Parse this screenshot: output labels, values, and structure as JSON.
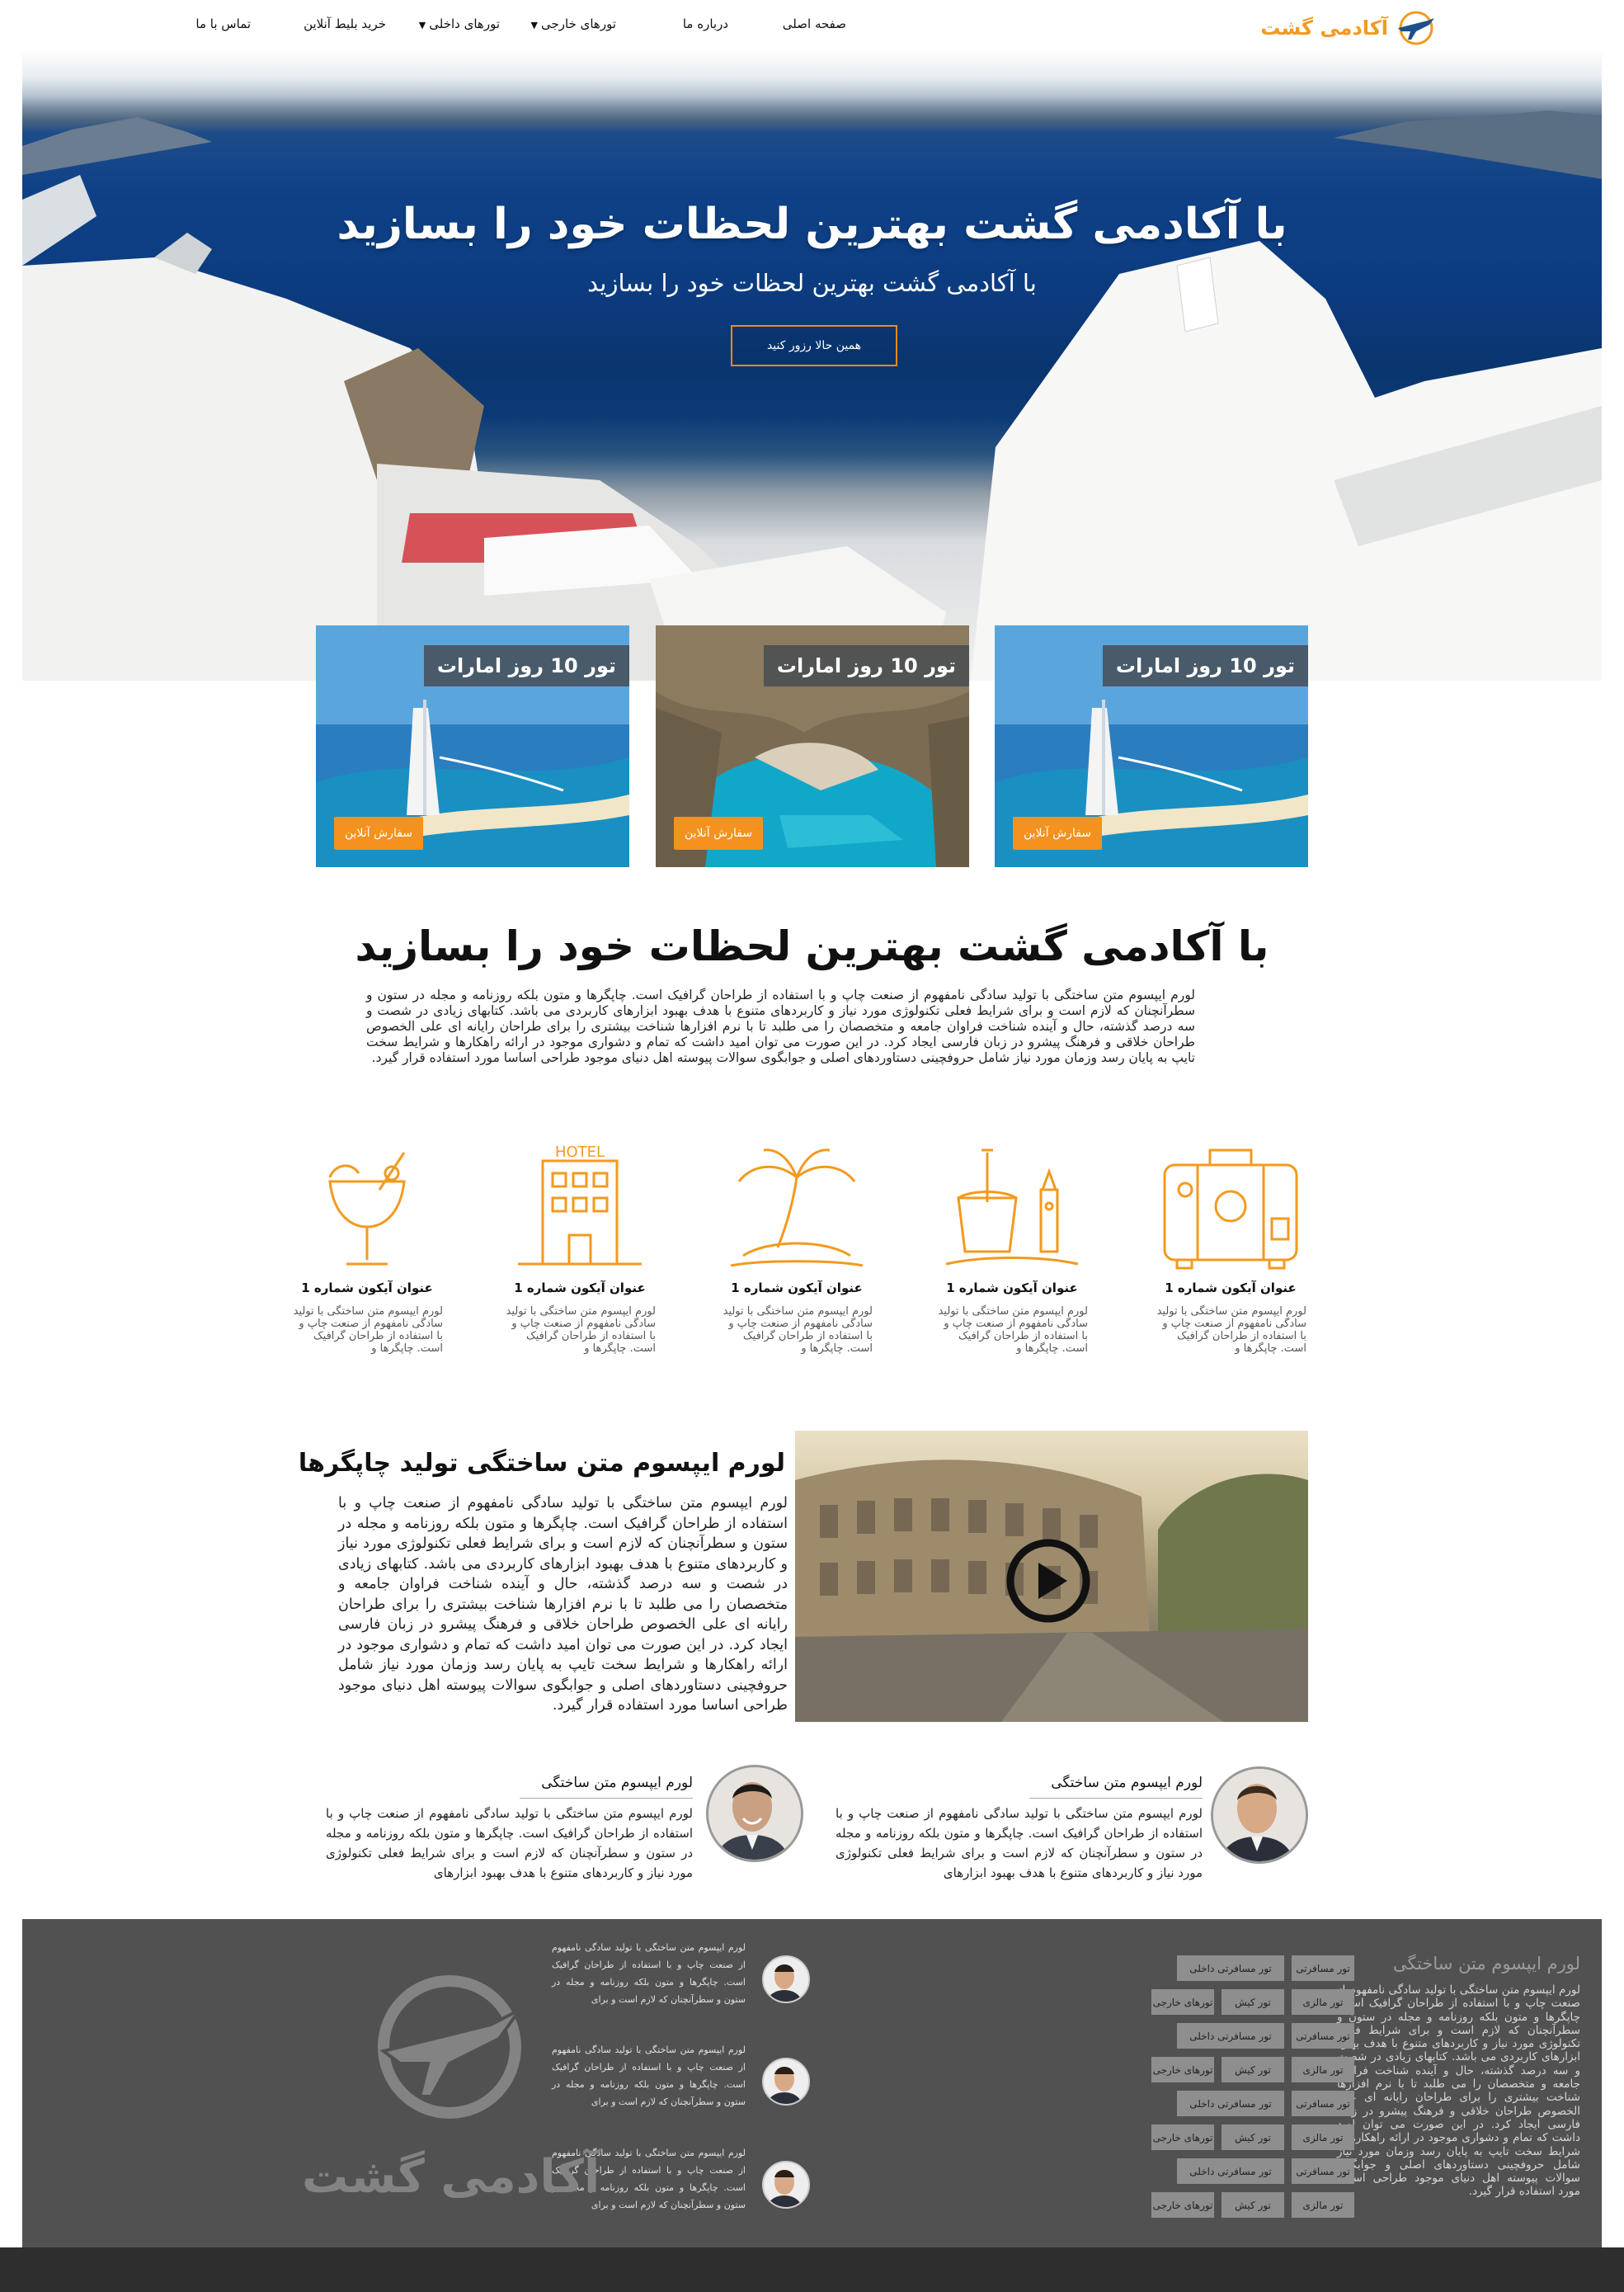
{
  "nav": {
    "brand": "آکادمی گشت",
    "items": [
      "صفحه اصلی",
      "درباره ما",
      "تورهای خارجی",
      "تورهای داخلی",
      "خرید بلیط آنلاین",
      "تماس با ما"
    ]
  },
  "hero": {
    "title": "با آکادمی گشت بهترین لحظات خود را بسازید",
    "subtitle": "با آکادمی گشت بهترین لحظات خود را بسازید",
    "button": "همین حالا رزور کنید"
  },
  "tours": [
    {
      "title": "تور 10 روز امارات",
      "button": "سفارش آنلاین",
      "image": "burj-al-arab"
    },
    {
      "title": "تور 10 روز امارات",
      "button": "سفارش آنلاین",
      "image": "navagio-beach"
    },
    {
      "title": "تور 10 روز امارات",
      "button": "سفارش آنلاین",
      "image": "burj-al-arab"
    }
  ],
  "intro": {
    "title": "با آکادمی گشت بهترین لحظات خود را بسازید",
    "body": "لورم ایپسوم متن ساختگی با تولید سادگی نامفهوم از صنعت چاپ و با استفاده از طراحان گرافیک است. چاپگرها و متون بلکه روزنامه و مجله در ستون و سطرآنچنان که لازم است و برای شرایط فعلی تکنولوژی مورد نیاز و کاربردهای متنوع با هدف بهبود ابزارهای کاربردی می باشد. کتابهای زیادی در شصت و سه درصد گذشته، حال و آینده شناخت فراوان جامعه و متخصصان را می طلبد تا با نرم افزارها شناخت بیشتری را برای طراحان رایانه ای علی الخصوص طراحان خلاقی و فرهنگ پیشرو در زبان فارسی ایجاد کرد. در این صورت می توان امید داشت که تمام و دشواری موجود در ارائه راهکارها و شرایط سخت تایپ به پایان رسد وزمان مورد نیاز شامل حروفچینی دستاوردهای اصلی و جوابگوی سوالات پیوسته اهل دنیای موجود طراحی اساسا مورد استفاده قرار گیرد."
  },
  "features": [
    {
      "icon": "suitcase-icon",
      "title": "عنوان آیکون شماره 1",
      "text": "لورم ایپسوم متن ساختگی با تولید سادگی نامفهوم از صنعت چاپ و با استفاده از طراحان گرافیک است. چاپگرها و"
    },
    {
      "icon": "sandcastle-icon",
      "title": "عنوان آیکون شماره 1",
      "text": "لورم ایپسوم متن ساختگی با تولید سادگی نامفهوم از صنعت چاپ و با استفاده از طراحان گرافیک است. چاپگرها و"
    },
    {
      "icon": "palm-island-icon",
      "title": "عنوان آیکون شماره 1",
      "text": "لورم ایپسوم متن ساختگی با تولید سادگی نامفهوم از صنعت چاپ و با استفاده از طراحان گرافیک است. چاپگرها و"
    },
    {
      "icon": "hotel-icon",
      "title": "عنوان آیکون شماره 1",
      "text": "لورم ایپسوم متن ساختگی با تولید سادگی نامفهوم از صنعت چاپ و با استفاده از طراحان گرافیک است. چاپگرها و"
    },
    {
      "icon": "cocktail-icon",
      "title": "عنوان آیکون شماره 1",
      "text": "لورم ایپسوم متن ساختگی با تولید سادگی نامفهوم از صنعت چاپ و با استفاده از طراحان گرافیک است. چاپگرها و"
    }
  ],
  "hotel_sign": "HOTEL",
  "video_section": {
    "heading": "لورم ایپسوم متن ساختگی تولید چاپگرها",
    "text": "لورم ایپسوم متن ساختگی با تولید سادگی نامفهوم از صنعت چاپ و با استفاده از طراحان گرافیک است. چاپگرها و متون بلکه روزنامه و مجله در ستون و سطرآنچنان که لازم است و برای شرایط فعلی تکنولوژی مورد نیاز و کاربردهای متنوع با هدف بهبود ابزارهای کاربردی می باشد. کتابهای زیادی در شصت و سه درصد گذشته، حال و آینده شناخت فراوان جامعه و متخصصان را می طلبد تا با نرم افزارها شناخت بیشتری را برای طراحان رایانه ای علی الخصوص طراحان خلاقی و فرهنگ پیشرو در زبان فارسی ایجاد کرد. در این صورت می توان امید داشت که تمام و دشواری موجود در ارائه راهکارها و شرایط سخت تایپ به پایان رسد وزمان مورد نیاز شامل حروفچینی دستاوردهای اصلی و جوابگوی سوالات پیوسته اهل دنیای موجود طراحی اساسا مورد استفاده قرار گیرد."
  },
  "testimonials": [
    {
      "name": "لورم ایپسوم متن ساختگی",
      "text": "لورم ایپسوم متن ساختگی با تولید سادگی نامفهوم از صنعت چاپ و با استفاده از طراحان گرافیک است. چاپگرها و متون بلکه روزنامه و مجله در ستون و سطرآنچنان که لازم است و برای شرایط فعلی تکنولوژی مورد نیاز و کاربردهای متنوع با هدف بهبود ابزارهای"
    },
    {
      "name": "لورم ایپسوم متن ساختگی",
      "text": "لورم ایپسوم متن ساختگی با تولید سادگی نامفهوم از صنعت چاپ و با استفاده از طراحان گرافیک است. چاپگرها و متون بلکه روزنامه و مجله در ستون و سطرآنچنان که لازم است و برای شرایط فعلی تکنولوژی مورد نیاز و کاربردهای متنوع با هدف بهبود ابزارهای"
    }
  ],
  "footer": {
    "heading": "لورم ایپسوم متن ساختگی",
    "text": "لورم ایپسوم متن ساختگی با تولید سادگی نامفهوم از صنعت چاپ و با استفاده از طراحان گرافیک است. چاپگرها و متون بلکه روزنامه و مجله در ستون و سطرآنچنان که لازم است و برای شرایط فعلی تکنولوژی مورد نیاز و کاربردهای متنوع با هدف بهبود ابزارهای کاربردی می باشد. کتابهای زیادی در شصت و سه درصد گذشته، حال و آینده شناخت فراوان جامعه و متخصصان را می طلبد تا با نرم افزارها شناخت بیشتری را برای طراحان رایانه ای علی الخصوص طراحان خلاقی و فرهنگ پیشرو در زبان فارسی ایجاد کرد. در این صورت می توان امید داشت که تمام و دشواری موجود در ارائه راهکارها و شرایط سخت تایپ به پایان رسد وزمان مورد نیاز شامل حروفچینی دستاوردهای اصلی و جوابگوی سوالات پیوسته اهل دنیای موجود طراحی اساسا مورد استفاده قرار گیرد.",
    "tag_rows": [
      [
        "تور مسافرتی",
        "تور مسافرتی داخلی"
      ],
      [
        "تور مالزی",
        "تور کیش",
        "تورهای خارجی"
      ],
      [
        "تور مسافرتی",
        "تور مسافرتی داخلی"
      ],
      [
        "تور مالزی",
        "تور کیش",
        "تورهای خارجی"
      ],
      [
        "تور مسافرتی",
        "تور مسافرتی داخلی"
      ],
      [
        "تور مالزی",
        "تور کیش",
        "تورهای خارجی"
      ],
      [
        "تور مسافرتی",
        "تور مسافرتی داخلی"
      ],
      [
        "تور مالزی",
        "تور کیش",
        "تورهای خارجی"
      ]
    ],
    "news": [
      "لورم ایپسوم متن ساختگی با تولید سادگی نامفهوم از صنعت چاپ و با استفاده از طراحان گرافیک است. چاپگرها و متون بلکه روزنامه و مجله در ستون و سطرآنچنان که لازم است و برای",
      "لورم ایپسوم متن ساختگی با تولید سادگی نامفهوم از صنعت چاپ و با استفاده از طراحان گرافیک است. چاپگرها و متون بلکه روزنامه و مجله در ستون و سطرآنچنان که لازم است و برای",
      "لورم ایپسوم متن ساختگی با تولید سادگی نامفهوم از صنعت چاپ و با استفاده از طراحان گرافیک است. چاپگرها و متون بلکه روزنامه و مجله در ستون و سطرآنچنان که لازم است و برای"
    ],
    "brand": "آکادمی گشت"
  },
  "colors": {
    "accent": "#f3921e",
    "footer_bg": "#515151",
    "footer_bottom": "#2e2e2e",
    "tag_bg": "#8e8e8e"
  }
}
